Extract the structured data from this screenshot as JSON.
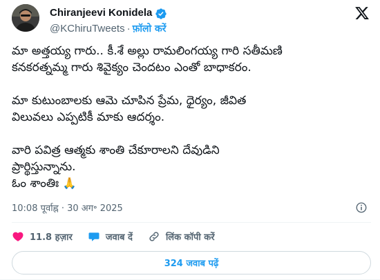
{
  "author": {
    "display_name": "Chiranjeevi Konidela",
    "handle": "@KChiruTweets",
    "separator": "·",
    "follow_label": "फ़ॉलो करें",
    "verified": true,
    "avatar_icon": "profile-photo"
  },
  "platform_icon": "x-logo-icon",
  "tweet": {
    "paragraph_1_line_1": "మా అత్తయ్య గారు.. కీ.శే అల్లు రామలింగయ్య గారి సతీమణి",
    "paragraph_1_line_2": "కనకరత్నమ్మ గారు శివైక్యం చెందటం ఎంతో బాధాకరం.",
    "paragraph_2_line_1": "మా కుటుంబాలకు ఆమె చూపిన ప్రేమ, ధైర్యం, జీవిత",
    "paragraph_2_line_2": "విలువలు ఎప్పటికీ మాకు ఆదర్శం.",
    "paragraph_3_line_1": "వారి పవిత్ర ఆత్మకు శాంతి చేకూరాలని దేవుడిని",
    "paragraph_3_line_2": "ప్రార్థిస్తున్నాను.",
    "paragraph_3_line_3": "ఓం శాంతిః",
    "emoji": "🙏"
  },
  "meta": {
    "time": "10:08 पूर्वाह्न",
    "separator": "·",
    "date": "30 अग॰ 2025"
  },
  "actions": {
    "likes_count": "11.8 हज़ार",
    "reply_label": "जवाब दें",
    "copy_link_label": "लिंक कॉपी करें"
  },
  "replies_button_label": "324 जवाब पढ़ें",
  "colors": {
    "accent": "#1d9bf0",
    "like": "#f91880",
    "muted": "#536471",
    "text": "#0f1419"
  }
}
